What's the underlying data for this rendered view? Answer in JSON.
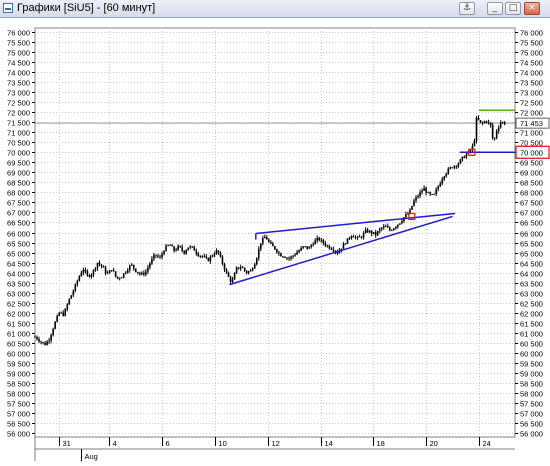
{
  "window": {
    "title": "Графики [SiU5] - [60 минут]",
    "buttons": [
      "⚓",
      "_",
      "□",
      "×"
    ]
  },
  "chart_data": {
    "type": "candlestick",
    "instrument": "SiU5",
    "timeframe": "60 минут",
    "ylim": [
      55800,
      76200
    ],
    "y_ticks": [
      56000,
      56500,
      57000,
      57500,
      58000,
      58500,
      59000,
      59500,
      60000,
      60500,
      61000,
      61500,
      62000,
      62500,
      63000,
      63500,
      64000,
      64500,
      65000,
      65500,
      66000,
      66500,
      67000,
      67500,
      68000,
      68500,
      69000,
      69500,
      70000,
      70500,
      71000,
      71500,
      72000,
      72500,
      73000,
      73500,
      74000,
      74500,
      75000,
      75500,
      76000
    ],
    "y_tick_labels": [
      "56 000",
      "56 500",
      "57 000",
      "57 500",
      "58 000",
      "58 500",
      "59 000",
      "59 500",
      "60 000",
      "60 500",
      "61 000",
      "61 500",
      "62 000",
      "62 500",
      "63 000",
      "63 500",
      "64 000",
      "64 500",
      "65 000",
      "65 500",
      "66 000",
      "66 500",
      "67 000",
      "67 500",
      "68 000",
      "68 500",
      "69 000",
      "69 500",
      "70 000",
      "70 500",
      "71 000",
      "71 500",
      "72 000",
      "72 500",
      "73 000",
      "73 500",
      "74 000",
      "74 500",
      "75 000",
      "75 500",
      "76 000"
    ],
    "x_ticks": [
      {
        "label": "31",
        "x": 0.05
      },
      {
        "label": "4",
        "x": 0.155
      },
      {
        "label": "6",
        "x": 0.265
      },
      {
        "label": "10",
        "x": 0.375
      },
      {
        "label": "12",
        "x": 0.485
      },
      {
        "label": "14",
        "x": 0.595
      },
      {
        "label": "18",
        "x": 0.705
      },
      {
        "label": "20",
        "x": 0.815
      },
      {
        "label": "24",
        "x": 0.925
      }
    ],
    "month_label": {
      "label": "Aug",
      "x": 0.095
    },
    "price_path": [
      [
        0.0,
        60800
      ],
      [
        0.01,
        60600
      ],
      [
        0.02,
        60400
      ],
      [
        0.03,
        60700
      ],
      [
        0.04,
        61400
      ],
      [
        0.05,
        62000
      ],
      [
        0.06,
        61900
      ],
      [
        0.07,
        62600
      ],
      [
        0.08,
        63100
      ],
      [
        0.09,
        63700
      ],
      [
        0.1,
        64200
      ],
      [
        0.11,
        63800
      ],
      [
        0.12,
        64000
      ],
      [
        0.13,
        64500
      ],
      [
        0.14,
        64300
      ],
      [
        0.15,
        63900
      ],
      [
        0.16,
        64200
      ],
      [
        0.17,
        63700
      ],
      [
        0.18,
        63800
      ],
      [
        0.19,
        64100
      ],
      [
        0.2,
        64400
      ],
      [
        0.21,
        64100
      ],
      [
        0.22,
        63900
      ],
      [
        0.23,
        64000
      ],
      [
        0.24,
        64500
      ],
      [
        0.25,
        64900
      ],
      [
        0.26,
        64700
      ],
      [
        0.27,
        65200
      ],
      [
        0.28,
        65400
      ],
      [
        0.29,
        65100
      ],
      [
        0.3,
        65300
      ],
      [
        0.31,
        65000
      ],
      [
        0.32,
        65300
      ],
      [
        0.33,
        65200
      ],
      [
        0.34,
        64900
      ],
      [
        0.35,
        64800
      ],
      [
        0.36,
        64600
      ],
      [
        0.37,
        64900
      ],
      [
        0.38,
        65100
      ],
      [
        0.39,
        64500
      ],
      [
        0.4,
        63900
      ],
      [
        0.41,
        63500
      ],
      [
        0.42,
        64200
      ],
      [
        0.43,
        64300
      ],
      [
        0.44,
        64000
      ],
      [
        0.45,
        64100
      ],
      [
        0.46,
        64600
      ],
      [
        0.47,
        65500
      ],
      [
        0.48,
        65800
      ],
      [
        0.49,
        65400
      ],
      [
        0.5,
        65200
      ],
      [
        0.51,
        64900
      ],
      [
        0.52,
        64800
      ],
      [
        0.53,
        64700
      ],
      [
        0.54,
        64900
      ],
      [
        0.55,
        65100
      ],
      [
        0.56,
        65300
      ],
      [
        0.57,
        65200
      ],
      [
        0.58,
        65500
      ],
      [
        0.59,
        65700
      ],
      [
        0.6,
        65500
      ],
      [
        0.61,
        65300
      ],
      [
        0.62,
        65200
      ],
      [
        0.63,
        65000
      ],
      [
        0.64,
        65300
      ],
      [
        0.65,
        65600
      ],
      [
        0.66,
        65900
      ],
      [
        0.67,
        65700
      ],
      [
        0.68,
        65800
      ],
      [
        0.69,
        66100
      ],
      [
        0.7,
        66000
      ],
      [
        0.71,
        65900
      ],
      [
        0.72,
        66200
      ],
      [
        0.73,
        66300
      ],
      [
        0.74,
        66100
      ],
      [
        0.75,
        66300
      ],
      [
        0.76,
        66500
      ],
      [
        0.77,
        66800
      ],
      [
        0.78,
        67000
      ],
      [
        0.79,
        67600
      ],
      [
        0.8,
        67900
      ],
      [
        0.81,
        68200
      ],
      [
        0.82,
        67900
      ],
      [
        0.83,
        67800
      ],
      [
        0.84,
        68300
      ],
      [
        0.85,
        68800
      ],
      [
        0.86,
        69100
      ],
      [
        0.87,
        69300
      ],
      [
        0.88,
        69400
      ],
      [
        0.89,
        69700
      ],
      [
        0.9,
        69900
      ],
      [
        0.91,
        70200
      ],
      [
        0.915,
        70500
      ],
      [
        0.92,
        71700
      ],
      [
        0.93,
        71400
      ],
      [
        0.94,
        71600
      ],
      [
        0.95,
        71300
      ],
      [
        0.955,
        70400
      ],
      [
        0.96,
        71000
      ],
      [
        0.97,
        71500
      ],
      [
        0.98,
        71453
      ]
    ],
    "overlays": {
      "triangle_upper": [
        [
          0.46,
          65950
        ],
        [
          0.875,
          66950
        ]
      ],
      "triangle_lower": [
        [
          0.405,
          63400
        ],
        [
          0.87,
          66800
        ]
      ],
      "level_blue": {
        "value": 70000,
        "x_start": 0.885
      },
      "level_green": {
        "value": 72100,
        "x_start": 0.925
      },
      "last_price_line": {
        "value": 71453
      },
      "markers": [
        [
          0.785,
          66800
        ],
        [
          0.91,
          70000
        ]
      ]
    },
    "price_labels": [
      {
        "value": 71453,
        "text": "71 453",
        "style": "last"
      },
      {
        "value": 70000,
        "text": "70 000",
        "style": "marked"
      }
    ],
    "colors": {
      "candles": "#000000",
      "trend_lines": "#1c1ccc",
      "level_green": "#4caf1f",
      "marker": "#dd2222",
      "grid": "#c8c8c8",
      "last_price_line": "#9a9a9a"
    }
  }
}
